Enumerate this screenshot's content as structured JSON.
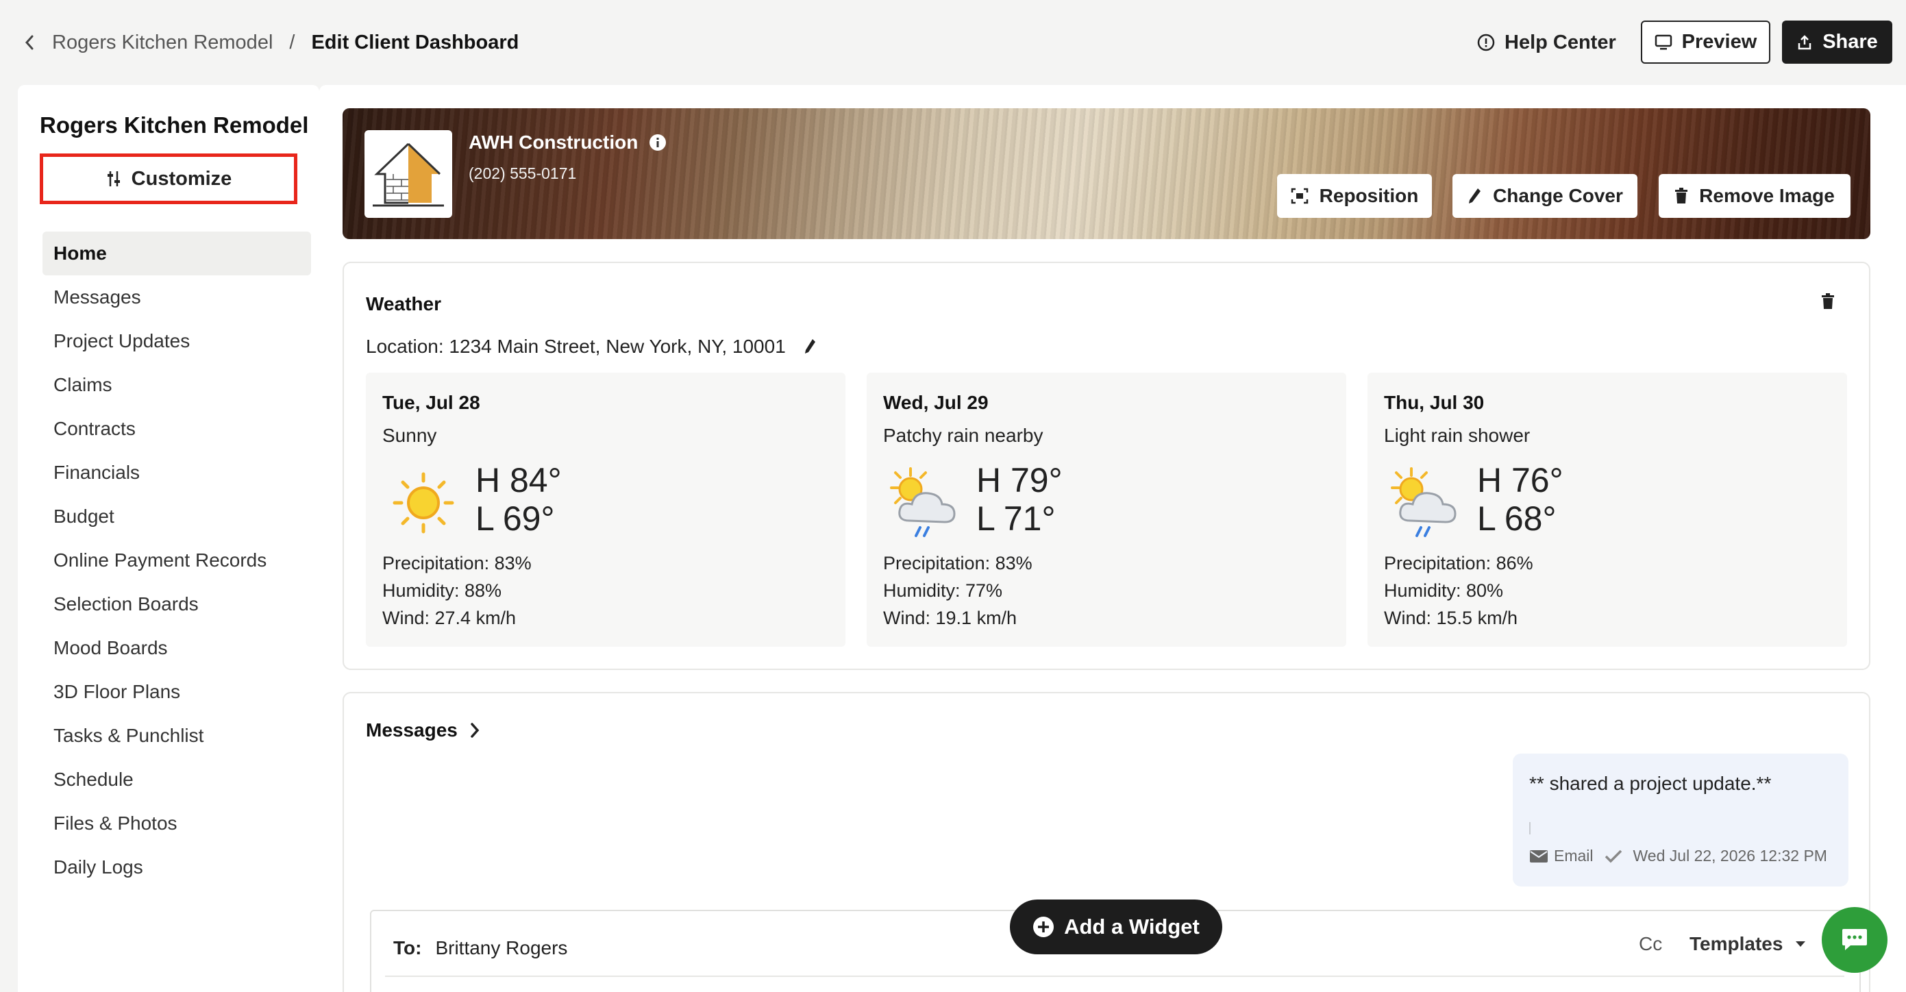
{
  "breadcrumb": {
    "parent": "Rogers Kitchen Remodel",
    "separator": "/",
    "current": "Edit Client Dashboard"
  },
  "header": {
    "help_label": "Help Center",
    "preview_label": "Preview",
    "share_label": "Share"
  },
  "sidebar": {
    "project_title": "Rogers Kitchen Remodel",
    "customize_label": "Customize",
    "items": [
      {
        "label": "Home",
        "active": true
      },
      {
        "label": "Messages"
      },
      {
        "label": "Project Updates"
      },
      {
        "label": "Claims"
      },
      {
        "label": "Contracts"
      },
      {
        "label": "Financials"
      },
      {
        "label": "Budget"
      },
      {
        "label": "Online Payment Records"
      },
      {
        "label": "Selection Boards"
      },
      {
        "label": "Mood Boards"
      },
      {
        "label": "3D Floor Plans"
      },
      {
        "label": "Tasks & Punchlist"
      },
      {
        "label": "Schedule"
      },
      {
        "label": "Files & Photos"
      },
      {
        "label": "Daily Logs"
      }
    ]
  },
  "cover": {
    "company": "AWH Construction",
    "phone": "(202) 555-0171",
    "reposition_label": "Reposition",
    "change_cover_label": "Change Cover",
    "remove_image_label": "Remove Image"
  },
  "weather": {
    "title": "Weather",
    "location": "Location: 1234 Main Street, New York, NY, 10001",
    "days": [
      {
        "date": "Tue, Jul 28",
        "condition": "Sunny",
        "icon": "sun-icon",
        "high": "H 84°",
        "low": "L 69°",
        "precip": "Precipitation: 83%",
        "humidity": "Humidity: 88%",
        "wind": "Wind: 27.4 km/h"
      },
      {
        "date": "Wed, Jul 29",
        "condition": "Patchy rain nearby",
        "icon": "sun-cloud-rain-icon",
        "high": "H 79°",
        "low": "L 71°",
        "precip": "Precipitation: 83%",
        "humidity": "Humidity: 77%",
        "wind": "Wind: 19.1 km/h"
      },
      {
        "date": "Thu, Jul 30",
        "condition": "Light rain shower",
        "icon": "sun-cloud-rain-icon",
        "high": "H 76°",
        "low": "L 68°",
        "precip": "Precipitation: 86%",
        "humidity": "Humidity: 80%",
        "wind": "Wind: 15.5 km/h"
      }
    ]
  },
  "messages": {
    "title": "Messages",
    "bubble_text": "** shared a project update.**",
    "bubble_channel": "Email",
    "bubble_time": "Wed Jul 22, 2026 12:32 PM",
    "to_label": "To:",
    "to_value": "Brittany Rogers",
    "cc_label": "Cc",
    "templates_label": "Templates"
  },
  "add_widget_label": "Add a Widget",
  "colors": {
    "accent_dark": "#1d1d1d",
    "highlight_border": "#e8261b",
    "chat_green": "#2e9e3a"
  }
}
